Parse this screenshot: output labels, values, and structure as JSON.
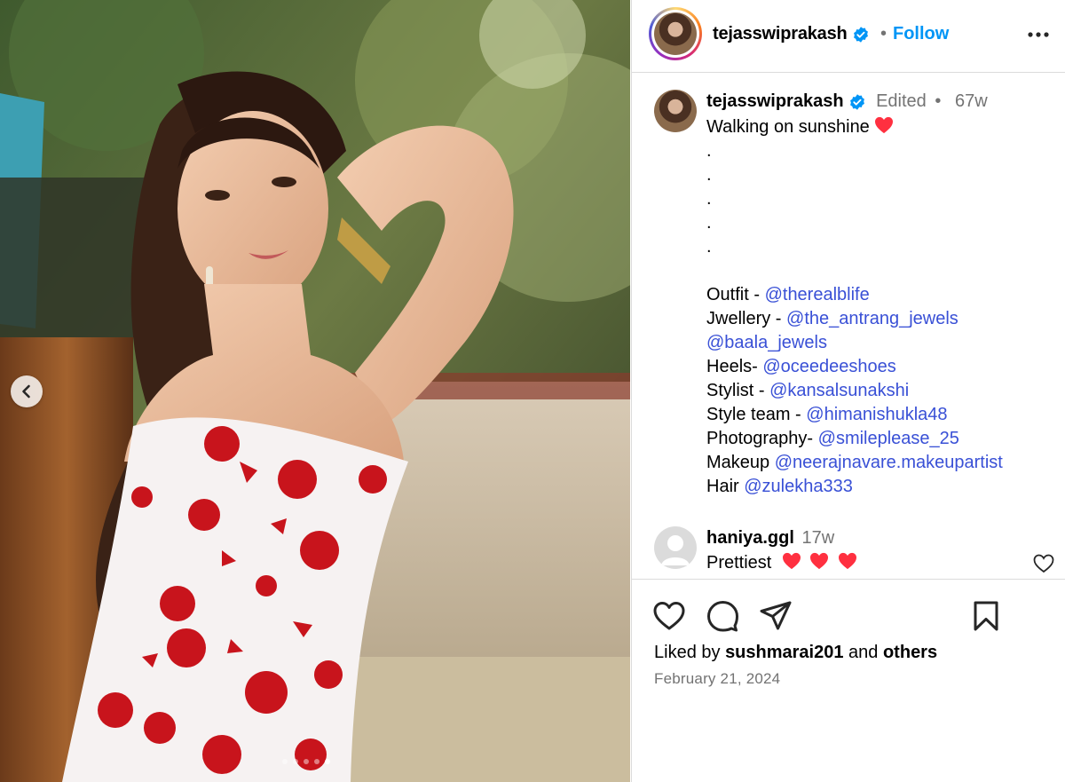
{
  "post": {
    "author": "tejasswiprakash",
    "follow_label": "Follow",
    "separator": "•",
    "slides": {
      "count": 5,
      "active_index": 4
    }
  },
  "caption": {
    "username": "tejasswiprakash",
    "edited_label": "Edited",
    "dot": "•",
    "age": "67w",
    "title_text": "Walking on sunshine",
    "title_emoji": "❤️",
    "dots": [
      ".",
      ".",
      ".",
      ".",
      "."
    ],
    "credits": [
      {
        "label": "Outfit - ",
        "mention": "@therealblife"
      },
      {
        "label": "Jwellery - ",
        "mention": "@the_antrang_jewels"
      },
      {
        "label": "",
        "mention": "@baala_jewels"
      },
      {
        "label": "Heels- ",
        "mention": "@oceedeeshoes"
      },
      {
        "label": "Stylist - ",
        "mention": "@kansalsunakshi"
      },
      {
        "label": "Style team - ",
        "mention": "@himanishukla48"
      },
      {
        "label": "Photography- ",
        "mention": "@smileplease_25"
      },
      {
        "label": "Makeup ",
        "mention": "@neerajnavare.makeupartist"
      },
      {
        "label": "Hair ",
        "mention": "@zulekha333"
      }
    ]
  },
  "comment": {
    "username": "haniya.ggl",
    "age": "17w",
    "text": "Prettiest",
    "emojis": "❤️ ❤️ ❤️"
  },
  "engagement": {
    "liked_prefix": "Liked by ",
    "liked_user": "sushmarai201",
    "liked_mid": " and ",
    "liked_others": "others",
    "date": "February 21, 2024"
  },
  "icons": {
    "like": "heart-icon",
    "comment": "comment-icon",
    "share": "share-icon",
    "save": "bookmark-icon",
    "more": "more-options-icon",
    "prev": "chevron-left-icon",
    "verified": "verified-badge-icon"
  },
  "colors": {
    "link": "#3950d6",
    "follow": "#0095f6",
    "verified": "#0095f6",
    "heart": "#ff3040",
    "muted": "#737373",
    "dress_red": "#c8141c"
  }
}
